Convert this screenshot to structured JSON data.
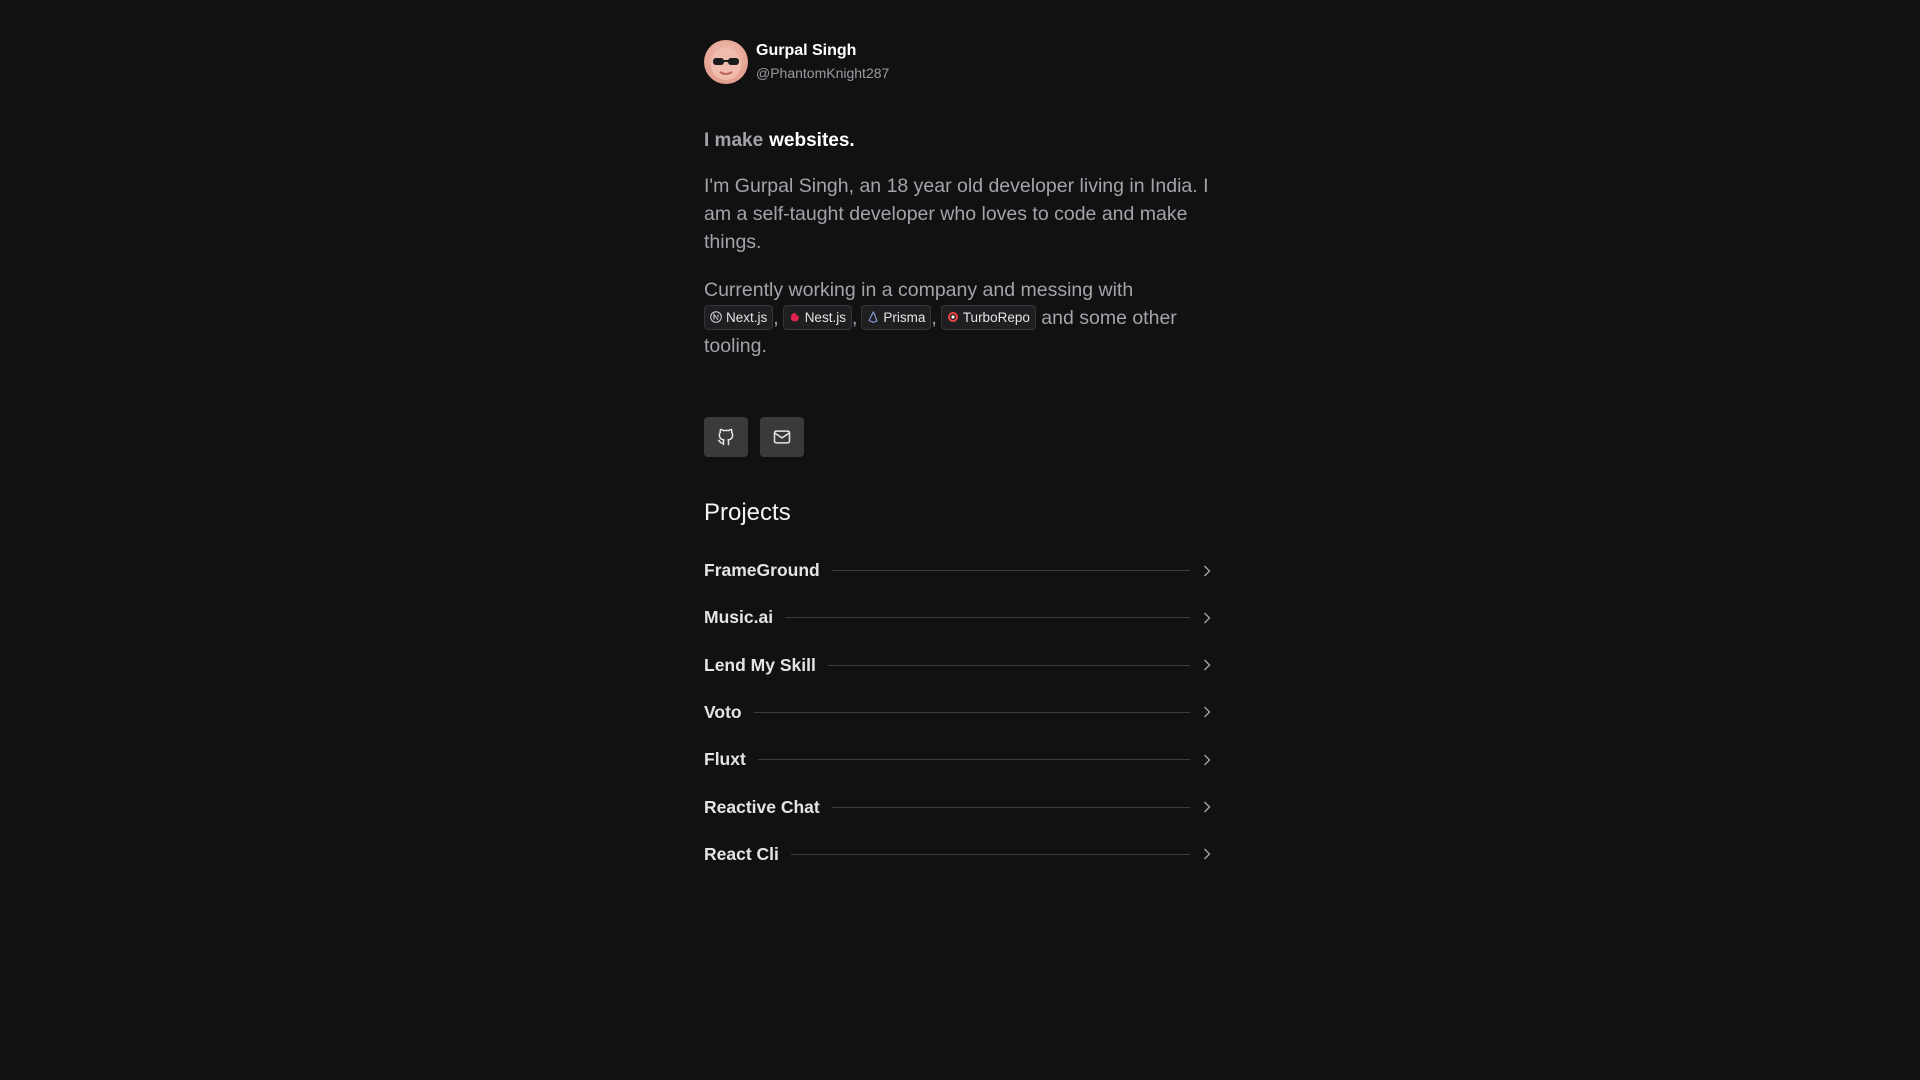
{
  "profile": {
    "name": "Gurpal Singh",
    "handle": "@PhantomKnight287"
  },
  "headline": {
    "prefix": "I make",
    "accent": "websites."
  },
  "intro": {
    "text": "I'm Gurpal Singh, an 18 year old developer living in India. I am a self-taught developer who loves to code and make things."
  },
  "currently": {
    "prefix": "Currently working in a company and messing with",
    "suffix": "and some other tooling.",
    "tools": [
      {
        "label": "Next.js",
        "icon": "nextjs-icon"
      },
      {
        "label": "Nest.js",
        "icon": "nestjs-icon"
      },
      {
        "label": "Prisma",
        "icon": "prisma-icon"
      },
      {
        "label": "TurboRepo",
        "icon": "turborepo-icon"
      }
    ]
  },
  "socials": [
    {
      "name": "github",
      "icon": "github-icon"
    },
    {
      "name": "email",
      "icon": "mail-icon"
    }
  ],
  "projects": {
    "title": "Projects",
    "items": [
      {
        "label": "FrameGround"
      },
      {
        "label": "Music.ai"
      },
      {
        "label": "Lend My Skill"
      },
      {
        "label": "Voto"
      },
      {
        "label": "Fluxt"
      },
      {
        "label": "Reactive Chat"
      },
      {
        "label": "React Cli"
      }
    ]
  },
  "colors": {
    "background": "#111112",
    "text_muted": "#a3a3ab",
    "text_strong": "#ffffff",
    "chip_bg": "#1f1f22",
    "button_bg": "#3a3a3d"
  }
}
